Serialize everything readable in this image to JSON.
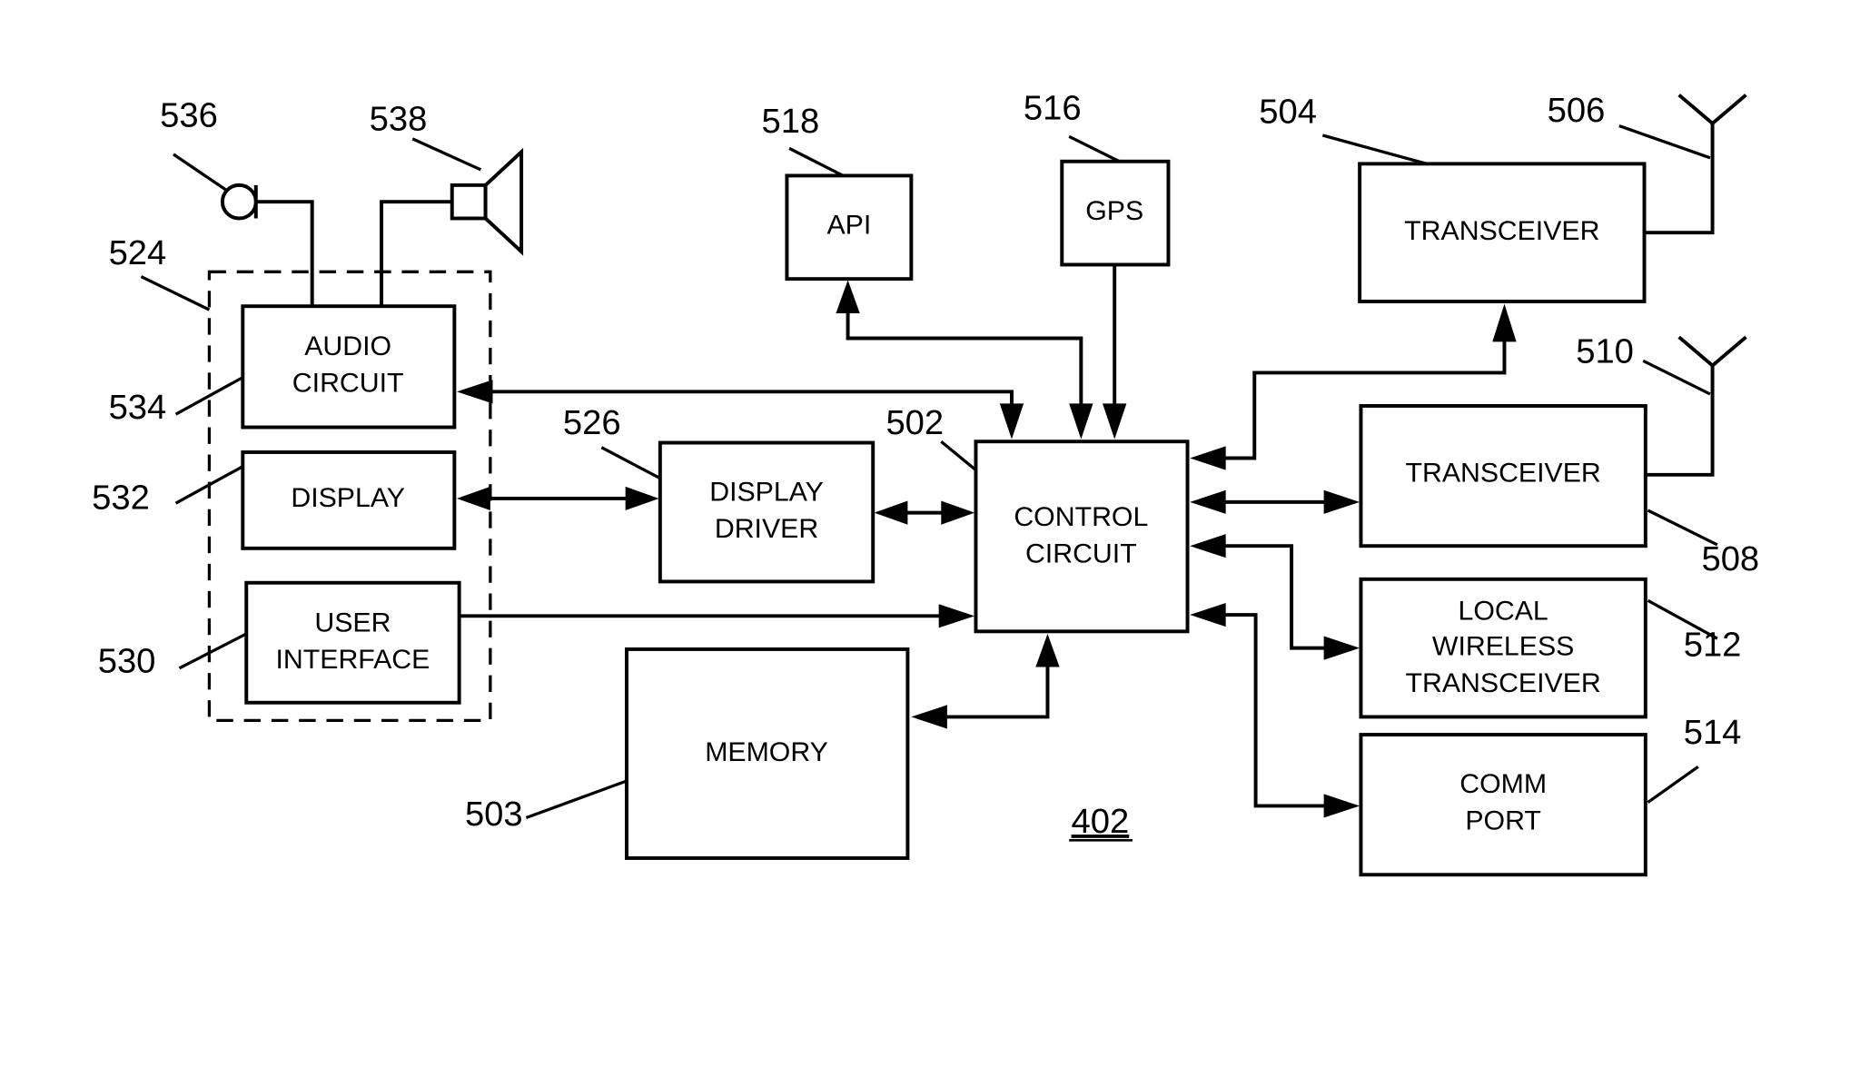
{
  "diagram": {
    "title_ref": "402",
    "blocks": {
      "control": {
        "ref": "502",
        "lines": [
          "CONTROL",
          "CIRCUIT"
        ]
      },
      "memory": {
        "ref": "503",
        "lines": [
          "MEMORY"
        ]
      },
      "transceiver1": {
        "ref": "504",
        "lines": [
          "TRANSCEIVER"
        ]
      },
      "transceiver2": {
        "ref": "508",
        "lines": [
          "TRANSCEIVER"
        ]
      },
      "local_wireless": {
        "ref": "512",
        "lines": [
          "LOCAL",
          "WIRELESS",
          "TRANSCEIVER"
        ]
      },
      "comm_port": {
        "ref": "514",
        "lines": [
          "COMM",
          "PORT"
        ]
      },
      "gps": {
        "ref": "516",
        "lines": [
          "GPS"
        ]
      },
      "api": {
        "ref": "518",
        "lines": [
          "API"
        ]
      },
      "display_driver": {
        "ref": "526",
        "lines": [
          "DISPLAY",
          "DRIVER"
        ]
      },
      "user_interface": {
        "ref": "530",
        "lines": [
          "USER",
          "INTERFACE"
        ]
      },
      "display": {
        "ref": "532",
        "lines": [
          "DISPLAY"
        ]
      },
      "audio": {
        "ref": "534",
        "lines": [
          "AUDIO",
          "CIRCUIT"
        ]
      }
    },
    "group_ref": "524",
    "antenna1_ref": "506",
    "antenna2_ref": "510",
    "microphone_ref": "536",
    "speaker_ref": "538"
  }
}
